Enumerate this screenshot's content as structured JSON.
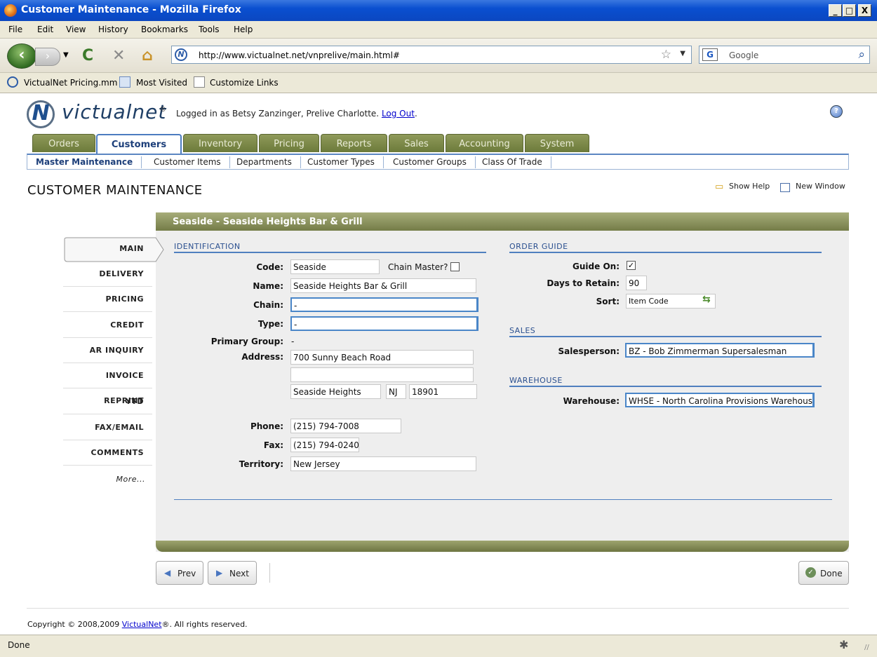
{
  "window": {
    "title": "Customer Maintenance - Mozilla Firefox",
    "min": "_",
    "max": "□",
    "close": "X"
  },
  "menu": [
    "File",
    "Edit",
    "View",
    "History",
    "Bookmarks",
    "Tools",
    "Help"
  ],
  "nav": {
    "url": "http://www.victualnet.net/vnprelive/main.html#",
    "search_placeholder": "Google",
    "search_engine": "G"
  },
  "bookmarks": [
    "VictualNet Pricing.mm",
    "Most Visited",
    "Customize Links"
  ],
  "header": {
    "logo_text": "victualnet",
    "logo_mark": "N",
    "logo_reg": "®",
    "logged_in_prefix": "Logged in as Betsy Zanzinger, Prelive Charlotte.",
    "logout": "Log Out",
    "logout_suffix": "."
  },
  "tabs": [
    "Orders",
    "Customers",
    "Inventory",
    "Pricing",
    "Reports",
    "Sales",
    "Accounting",
    "System"
  ],
  "active_tab": "Customers",
  "subtabs": [
    "Master Maintenance",
    "Customer Items",
    "Departments",
    "Customer Types",
    "Customer Groups",
    "Class Of Trade"
  ],
  "page_title": "CUSTOMER MAINTENANCE",
  "tools": {
    "show_help": "Show Help",
    "new_window": "New Window"
  },
  "panel_title": "Seaside - Seaside Heights Bar & Grill",
  "left_nav": [
    "MAIN",
    "DELIVERY",
    "PRICING",
    "CREDIT",
    "AR INQUIRY",
    "INVOICE REPRINT",
    "YTD",
    "FAX/EMAIL",
    "COMMENTS",
    "More..."
  ],
  "identification": {
    "section": "IDENTIFICATION",
    "code_label": "Code:",
    "code": "Seaside",
    "chain_master_label": "Chain Master?",
    "name_label": "Name:",
    "name": "Seaside Heights Bar & Grill",
    "chain_label": "Chain:",
    "chain": "-",
    "type_label": "Type:",
    "type": "-",
    "primary_group_label": "Primary Group:",
    "primary_group": "-",
    "address_label": "Address:",
    "address1": "700 Sunny Beach Road",
    "address2": "",
    "city": "Seaside Heights",
    "state": "NJ",
    "zip": "18901",
    "phone_label": "Phone:",
    "phone": "(215) 794-7008",
    "fax_label": "Fax:",
    "fax": "(215) 794-0240",
    "territory_label": "Territory:",
    "territory": "New Jersey"
  },
  "order_guide": {
    "section": "ORDER GUIDE",
    "guide_on_label": "Guide On:",
    "guide_on_mark": "✓",
    "days_label": "Days to Retain:",
    "days": "90",
    "sort_label": "Sort:",
    "sort": "Item Code"
  },
  "sales": {
    "section": "SALES",
    "salesperson_label": "Salesperson:",
    "salesperson": "BZ - Bob Zimmerman Supersalesman"
  },
  "warehouse": {
    "section": "WAREHOUSE",
    "warehouse_label": "Warehouse:",
    "warehouse": "WHSE - North Carolina Provisions Warehous"
  },
  "buttons": {
    "prev": "Prev",
    "next": "Next",
    "done": "Done"
  },
  "footer": {
    "copyright_prefix": "Copyright © 2008,2009",
    "company": "VictualNet",
    "copyright_suffix": "®. All rights reserved."
  },
  "status": "Done"
}
